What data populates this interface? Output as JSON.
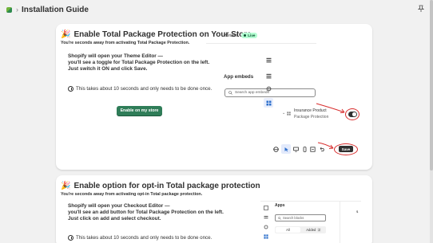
{
  "header": {
    "page_title": "Installation Guide",
    "separator": "›"
  },
  "card1": {
    "title": "Enable Total Package Protection on Your Store",
    "subtitle": "You're seconds away from activating Total Package Protection.",
    "instructions": [
      "Shopify will open your Theme Editor —",
      "you'll see a toggle for Total Package Protection on the left.",
      "Just switch it ON and click Save."
    ],
    "note": "This takes about 10 seconds and only needs to be done once.",
    "button_label": "Enable on my store",
    "editor": {
      "theme_name": "Horizon",
      "live_badge": "Live",
      "section_title": "App embeds",
      "search_placeholder": "Search app embeds",
      "embed_name": "Insurance Product",
      "embed_sub": "Package Protection",
      "save_label": "Save"
    }
  },
  "card2": {
    "title": "Enable option for opt-in Total package protection",
    "subtitle": "You're seconds away from activating opt-in Total package protection.",
    "instructions": [
      "Shopify will open your Checkout Editor —",
      "you'll see an add button for Total Package Protection on the left.",
      "Just click on add and select checkout."
    ],
    "note": "This takes about 10 seconds and only needs to be done once.",
    "editor": {
      "section_title": "Apps",
      "search_placeholder": "Search blocks",
      "tab_all": "All",
      "tab_added": "Added",
      "added_count": "2",
      "side_value": "$"
    }
  },
  "colors": {
    "accent_green": "#2f7d58",
    "highlight_red": "#d82c2c",
    "live_badge": "#b4fed2"
  }
}
